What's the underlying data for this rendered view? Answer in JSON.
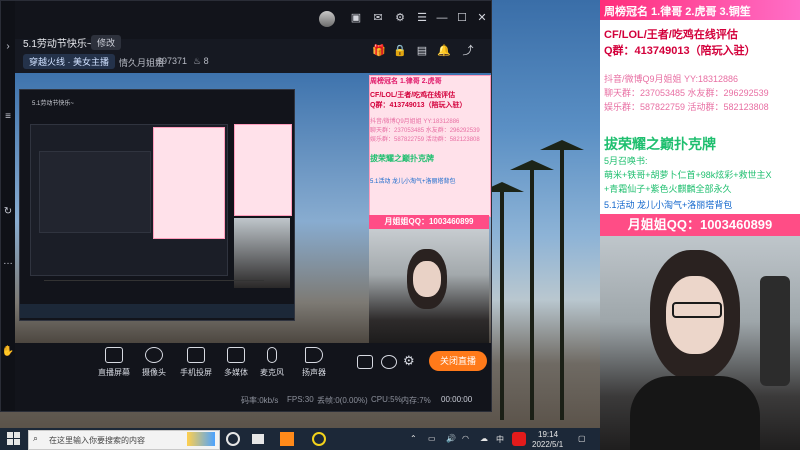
{
  "window": {
    "title": "5.1劳动节快乐~",
    "edit_label": "修改",
    "category": "穿越火线 · 美女主播",
    "streamer": "情久月姐姐",
    "viewers": "897371",
    "fans": "8"
  },
  "toolbar": {
    "items": [
      {
        "label": "直播屏幕"
      },
      {
        "label": "摄像头"
      },
      {
        "label": "手机投屏"
      },
      {
        "label": "多媒体"
      },
      {
        "label": "麦克风"
      },
      {
        "label": "扬声器"
      }
    ],
    "close_live_label": "关闭直播"
  },
  "status": {
    "bitrate": "码率:0kb/s",
    "fps": "FPS:30",
    "drop": "丢帧:0(0.00%)",
    "cpu": "CPU:5%",
    "memory": "内存:7%",
    "timer": "00:00:00"
  },
  "overlay": {
    "header": "周榜冠名 1.律哥 2.虎哥 3.铜笙",
    "line1": "CF/LOL/王者/吃鸡在线评估",
    "line2": "Q群：413749013（陪玩入驻）",
    "line3": "抖音/微博Q9月姐姐  YY:18312886",
    "line4": "聊天群：237053485 水友群：296292539",
    "line5": "娱乐群：587822759 活动群：582123808",
    "line6": "拔荣耀之巅扑克牌",
    "line7": "5月召唤书:",
    "line8": "萌米+铁哥+胡萝卜仁首+98k炫彩+救世主X",
    "line9": "+青霜仙子+紫色火麒麟全部永久",
    "line10": "5.1活动 龙儿小淘气+洛丽塔背包",
    "qq": "月姐姐QQ：1003460899"
  },
  "taskbar": {
    "search_placeholder": "在这里输入你要搜索的内容",
    "time": "19:14",
    "date": "2022/5/1",
    "ime": "中"
  },
  "colors": {
    "accent_orange": "#ff7a1a",
    "overlay_pink": "#ff2d7a",
    "qq_red": "#d3003b"
  }
}
